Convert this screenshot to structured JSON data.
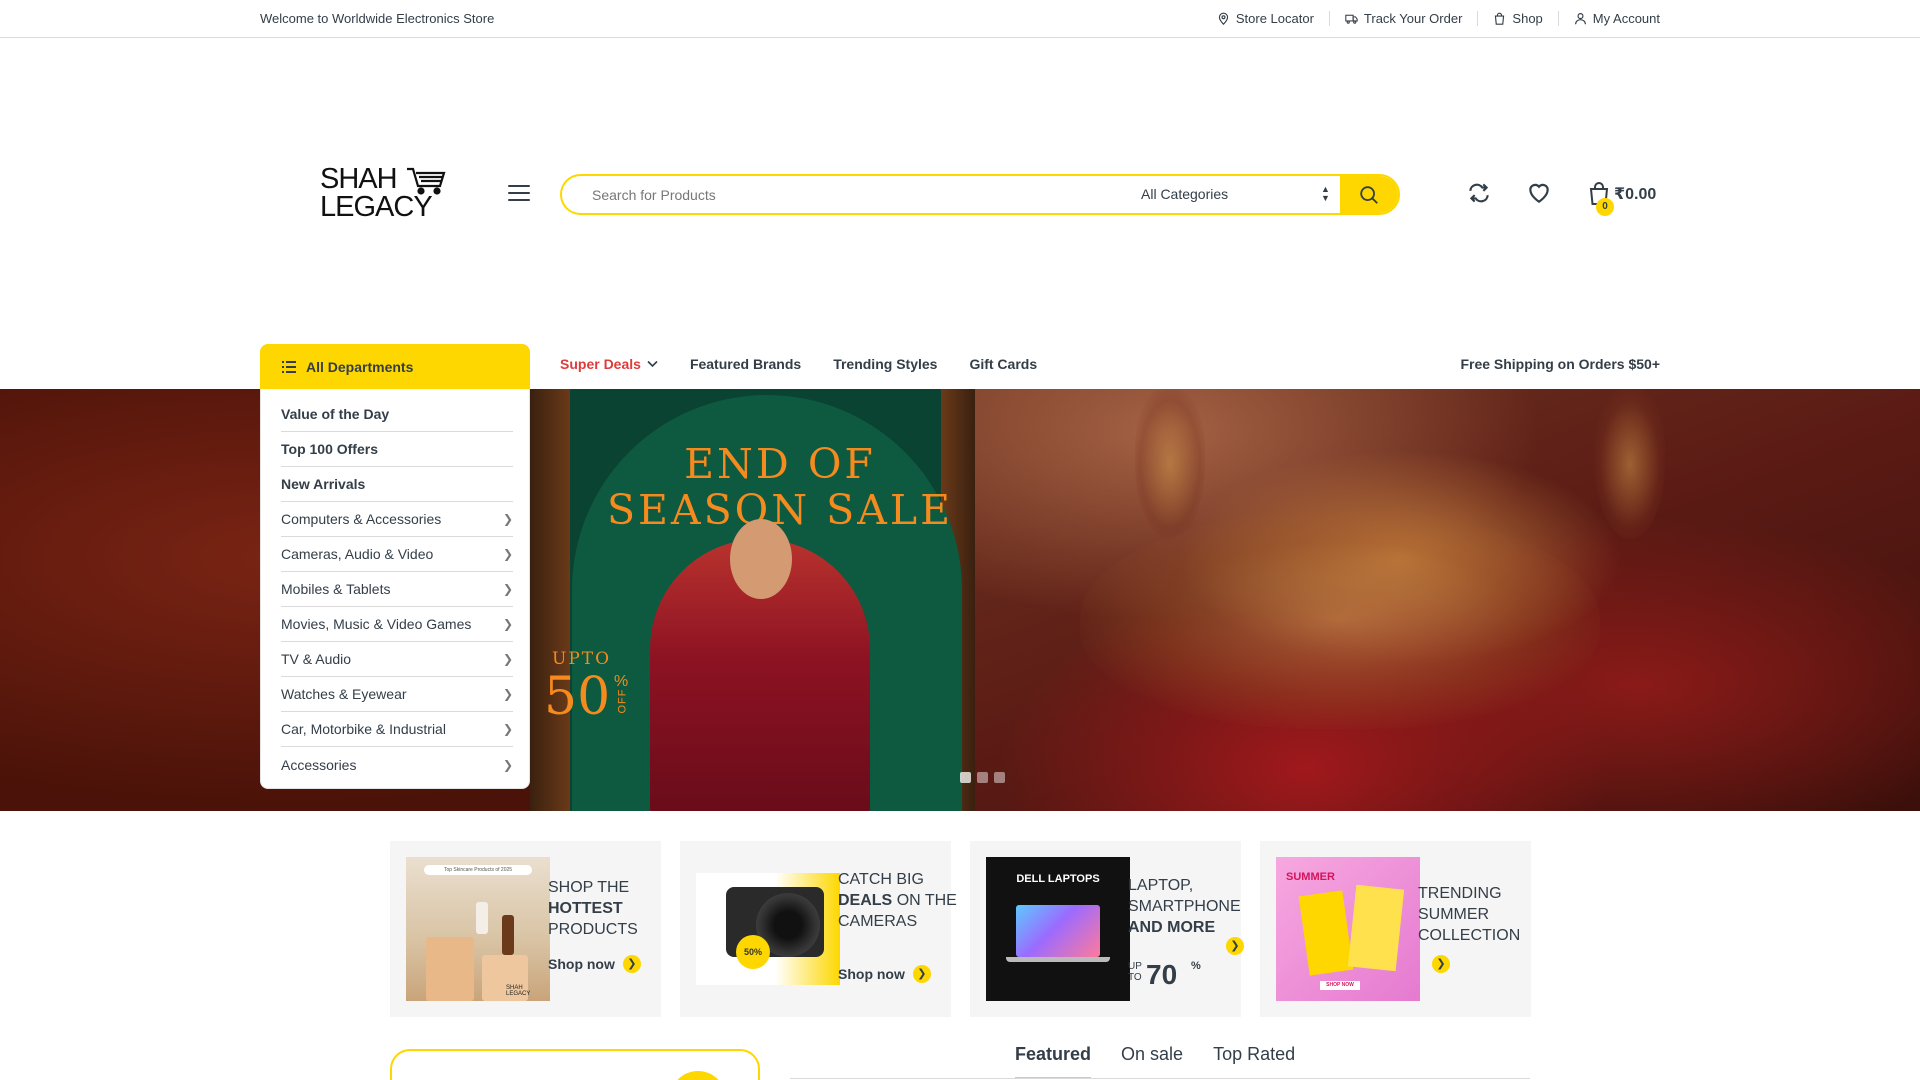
{
  "topbar": {
    "welcome": "Welcome to Worldwide Electronics Store",
    "links": [
      "Store Locator",
      "Track Your Order",
      "Shop",
      "My Account"
    ]
  },
  "header": {
    "logo_line1": "SHAH",
    "logo_line2": "LEGACY",
    "search_placeholder": "Search for Products",
    "category_selected": "All Categories",
    "cart_count": "0",
    "cart_total": "₹0.00"
  },
  "nav": {
    "departments_label": "All Departments",
    "items": [
      "Super Deals",
      "Featured Brands",
      "Trending Styles",
      "Gift Cards"
    ],
    "shipping_note": "Free Shipping on Orders $50+"
  },
  "departments": [
    {
      "label": "Value of the Day",
      "bold": true
    },
    {
      "label": "Top 100 Offers",
      "bold": true
    },
    {
      "label": "New Arrivals",
      "bold": true
    },
    {
      "label": "Computers & Accessories",
      "bold": false
    },
    {
      "label": "Cameras, Audio & Video",
      "bold": false
    },
    {
      "label": "Mobiles & Tablets",
      "bold": false
    },
    {
      "label": "Movies, Music & Video Games",
      "bold": false
    },
    {
      "label": "TV & Audio",
      "bold": false
    },
    {
      "label": "Watches & Eyewear",
      "bold": false
    },
    {
      "label": "Car, Motorbike & Industrial",
      "bold": false
    },
    {
      "label": "Accessories",
      "bold": false
    }
  ],
  "hero": {
    "title_line1": "END OF",
    "title_line2": "SEASON SALE",
    "upto": "UPTO",
    "discount": "50",
    "percent": "%",
    "off": "OFF",
    "slides": 3
  },
  "promos": [
    {
      "line1": "SHOP THE",
      "bold": "HOTTEST",
      "line3": "PRODUCTS",
      "cta": "Shop now",
      "img_caption": "Top Skincare Products of 2025"
    },
    {
      "line1": "CATCH BIG",
      "bold": "DEALS",
      "line2rest": "ON THE",
      "line3": "CAMERAS",
      "cta": "Shop now",
      "img_badge": "50%"
    },
    {
      "line1": "LAPTOP,",
      "line2": "SMARTPHONE",
      "bold": "AND MORE",
      "upto": "UP TO",
      "value": "70",
      "percent": "%",
      "img_caption": "DELL LAPTOPS"
    },
    {
      "line1": "TRENDING",
      "line2": "SUMMER",
      "line3": "COLLECTION",
      "img_caption": "SUMMER",
      "img_cta": "SHOP NOW"
    }
  ],
  "tabs": [
    "Featured",
    "On sale",
    "Top Rated"
  ],
  "colors": {
    "accent": "#fed700",
    "text": "#333e48",
    "deal": "#df3b3b"
  }
}
